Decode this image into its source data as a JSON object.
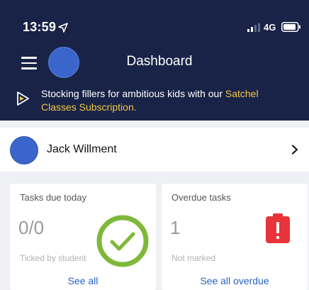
{
  "status": {
    "time": "13:59",
    "network": "4G",
    "icons": [
      "location-arrow-icon",
      "signal-icon",
      "battery-icon"
    ]
  },
  "header": {
    "title": "Dashboard",
    "menu_icon": "hamburger-menu-icon"
  },
  "promo": {
    "text_main": "Stocking fillers for ambitious kids with our ",
    "text_accent": "Satchel Classes Subscription.",
    "icon": "play-icon"
  },
  "profile": {
    "name": "Jack Willment",
    "icon": "chevron-right-icon"
  },
  "cards": [
    {
      "title": "Tasks due today",
      "count": "0/0",
      "subtitle": "Ticked by student",
      "link": "See all",
      "icon": "check-circle-icon"
    },
    {
      "title": "Overdue tasks",
      "count": "1",
      "subtitle": "Not marked",
      "link": "See all overdue",
      "icon": "alert-clipboard-icon"
    }
  ],
  "colors": {
    "header_bg": "#182347",
    "accent_yellow": "#f2c744",
    "check_green": "#7fb83a",
    "alert_red": "#e8333a",
    "link_blue": "#2a63c4",
    "avatar_blue": "#3a66cc"
  }
}
